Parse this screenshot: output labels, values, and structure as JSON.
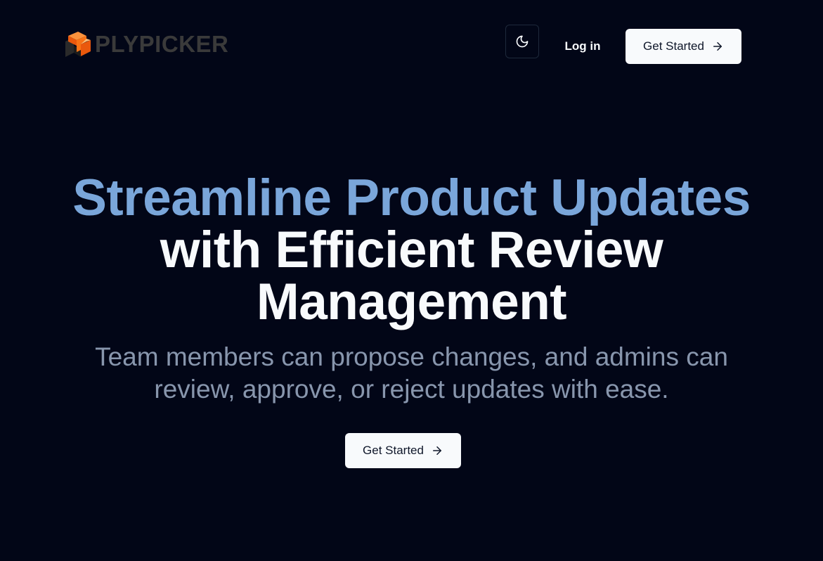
{
  "header": {
    "logo_text": "PLYPICKER",
    "theme_toggle_icon": "moon-icon",
    "login_label": "Log in",
    "cta_label": "Get Started",
    "cta_icon": "arrow-right-icon"
  },
  "hero": {
    "title_accent": "Streamline Product Updates",
    "title_rest": "with Efficient Review Management",
    "subtitle": "Team members can propose changes, and admins can review, approve, or reject updates with ease.",
    "cta_label": "Get Started",
    "cta_icon": "arrow-right-icon"
  },
  "colors": {
    "background": "#020617",
    "accent": "#7aa6da",
    "logo_orange": "#f97316",
    "button_bg": "#f8fafc",
    "subtitle": "#8896ad"
  }
}
